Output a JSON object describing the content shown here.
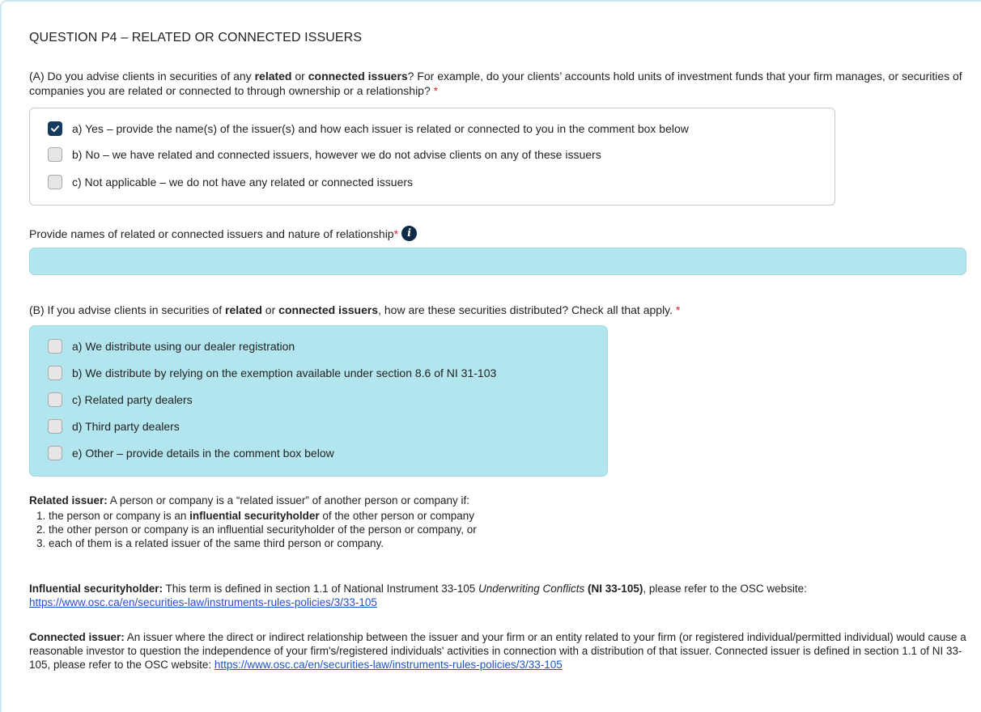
{
  "title": "QUESTION P4 – RELATED OR CONNECTED ISSUERS",
  "partA": {
    "t1": "(A) Do you advise clients in securities of any ",
    "b1": "related",
    "t2": " or ",
    "b2": "connected issuers",
    "t3": "? For example, do your clients’ accounts hold units of investment funds that your firm manages, or securities of companies you are related or connected to through ownership or a relationship? ",
    "required": "*",
    "options": [
      {
        "label": "a) Yes – provide the name(s) of the issuer(s) and how each issuer is related or connected to you in the comment box below",
        "checked": true
      },
      {
        "label": "b) No – we have related and connected issuers, however we do not advise clients on any of these issuers",
        "checked": false
      },
      {
        "label": "c) Not applicable – we do not have any related or connected issuers",
        "checked": false
      }
    ]
  },
  "comment": {
    "label": "Provide names of related or connected issuers and nature of relationship ",
    "required": "*",
    "info_icon": "i",
    "value": ""
  },
  "partB": {
    "t1": "(B) If you advise clients in securities of ",
    "b1": "related",
    "t2": " or ",
    "b2": "connected issuers",
    "t3": ", how are these securities distributed? Check all that apply. ",
    "required": "*",
    "options": [
      {
        "label": "a) We distribute using our dealer registration",
        "checked": false
      },
      {
        "label": "b) We distribute by relying on the exemption available under section 8.6 of NI 31-103",
        "checked": false
      },
      {
        "label": "c) Related party dealers",
        "checked": false
      },
      {
        "label": "d) Third party dealers",
        "checked": false
      },
      {
        "label": "e) Other – provide details in the comment box below",
        "checked": false
      }
    ]
  },
  "defs": {
    "related_term": "Related issuer:",
    "related_text": " A person or company is a “related issuer” of another person or company if:",
    "related_items": [
      {
        "a": "the person or company is an ",
        "b": "influential securityholder",
        "c": " of the other person or company"
      },
      {
        "a": "the other person or company is an influential securityholder of the person or company, or",
        "b": "",
        "c": ""
      },
      {
        "a": "each of them is a related issuer of the same third person or company.",
        "b": "",
        "c": ""
      }
    ],
    "influential_term": "Influential securityholder:",
    "influential_text1": " This term is defined in section 1.1 of National Instrument 33-105 ",
    "influential_italic": "Underwriting Conflicts",
    "influential_bold": " (NI 33-105)",
    "influential_text2": ", please refer to the OSC website: ",
    "influential_link": "https://www.osc.ca/en/securities-law/instruments-rules-policies/3/33-105",
    "connected_term": "Connected issuer:",
    "connected_text": " An issuer where the direct or indirect relationship between the issuer and your firm or an entity related to your firm (or registered individual/permitted individual) would cause a reasonable investor to question the independence of your firm's/registered individuals' activities in connection with a distribution of that issuer. Connected issuer is defined in section 1.1 of NI 33-105, please refer to the OSC website: ",
    "connected_link": "https://www.osc.ca/en/securities-law/instruments-rules-policies/3/33-105"
  }
}
